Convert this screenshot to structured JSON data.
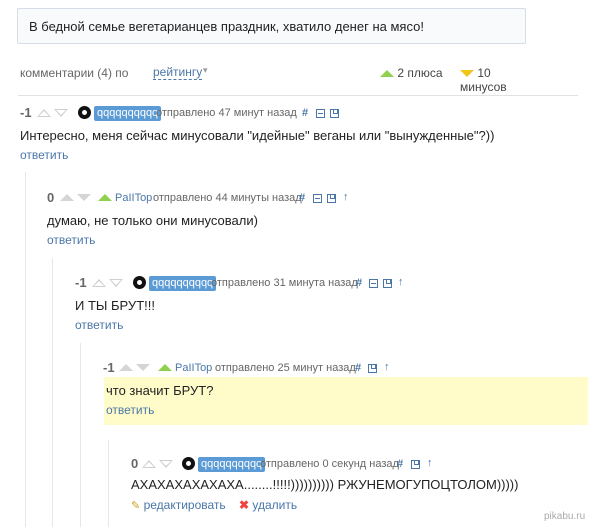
{
  "story": {
    "title": "В бедной семье вегетарианцев праздник, хватило денег на мясо!"
  },
  "comments_bar": {
    "count_label": "комментарии (4) по",
    "sort_value": "рейтингу",
    "caret": "▾",
    "plus_label": "2 плюса",
    "minus_label": "10 минусов"
  },
  "icons": {
    "hash": "#",
    "up": "↑",
    "pencil": "✎",
    "cross": "✖"
  },
  "comments": [
    {
      "rating": "-1",
      "user": "qqqqqqqqqq",
      "meta": "отправлено  47 минут назад",
      "text": "Интересно, меня сейчас минусовали \"идейные\" веганы или \"вынужденные\"?))",
      "reply": "ответить"
    },
    {
      "rating": "0",
      "user": "PaIITop",
      "meta": "отправлено  44 минуты назад",
      "text": "думаю, не только они минусовали)",
      "reply": "ответить"
    },
    {
      "rating": "-1",
      "user": "qqqqqqqqqq",
      "meta": "отправлено  31 минута назад",
      "text": "И ТЫ БРУТ!!!",
      "reply": "ответить"
    },
    {
      "rating": "-1",
      "user": "PaIITop",
      "meta": "отправлено  25 минут назад",
      "text": "что значит БРУТ?",
      "reply": "ответить"
    },
    {
      "rating": "0",
      "user": "qqqqqqqqqq",
      "meta": "отправлено  0 секунд назад",
      "text": "АХАХАХАХАХАХА........!!!!!)))))))))) РЖУНЕМОГУПОЦТОЛОМ)))))",
      "edit": "редактировать",
      "delete": "удалить"
    }
  ],
  "watermark": "pikabu.ru",
  "colors": {
    "link": "#4a76a8",
    "plus": "#8fd14f",
    "minus": "#f0c419",
    "highlight": "#fffcc9"
  }
}
